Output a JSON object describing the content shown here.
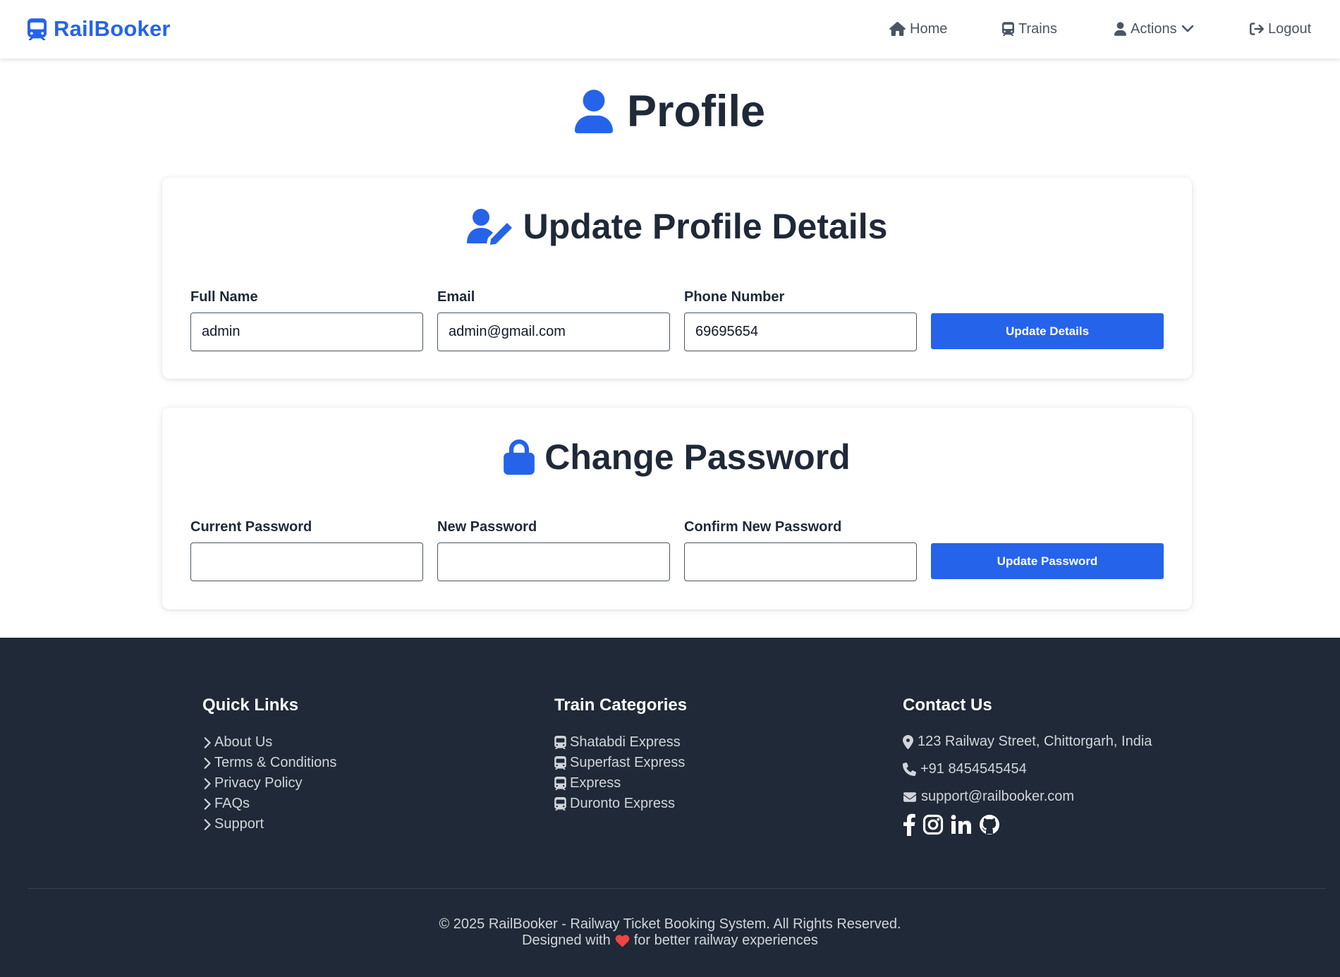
{
  "brand": {
    "name": "RailBooker",
    "icon": "train-icon",
    "color": "#2563eb"
  },
  "nav": {
    "items": [
      {
        "label": "Home",
        "icon": "home-icon"
      },
      {
        "label": "Trains",
        "icon": "train-icon"
      },
      {
        "label": "Actions",
        "icon": "user-icon",
        "dropdown_icon": "chevron-down-icon"
      },
      {
        "label": "Logout",
        "icon": "logout-icon"
      }
    ]
  },
  "page": {
    "title": "Profile",
    "title_icon": "user-icon"
  },
  "update_profile": {
    "title": "Update Profile Details",
    "title_icon": "user-edit-icon",
    "fields": [
      {
        "label": "Full Name",
        "value": "admin"
      },
      {
        "label": "Email",
        "value": "admin@gmail.com"
      },
      {
        "label": "Phone Number",
        "value": "69695654"
      }
    ],
    "button_label": "Update Details"
  },
  "change_password": {
    "title": "Change Password",
    "title_icon": "lock-icon",
    "fields": [
      {
        "label": "Current Password",
        "value": ""
      },
      {
        "label": "New Password",
        "value": ""
      },
      {
        "label": "Confirm New Password",
        "value": ""
      }
    ],
    "button_label": "Update Password"
  },
  "footer": {
    "quick_links": {
      "heading": "Quick Links",
      "items": [
        "About Us",
        "Terms & Conditions",
        "Privacy Policy",
        "FAQs",
        "Support"
      ]
    },
    "train_categories": {
      "heading": "Train Categories",
      "items": [
        "Shatabdi Express",
        "Superfast Express",
        "Express",
        "Duronto Express"
      ]
    },
    "contact": {
      "heading": "Contact Us",
      "address": "123 Railway Street, Chittorgarh, India",
      "phone": "+91 8454545454",
      "email": "support@railbooker.com",
      "socials": [
        "facebook-icon",
        "instagram-icon",
        "linkedin-icon",
        "github-icon"
      ]
    },
    "copyright": "© 2025 RailBooker - Railway Ticket Booking System. All Rights Reserved.",
    "designed_prefix": "Designed with",
    "designed_suffix": "for better railway experiences",
    "heart_color": "#ef4444"
  },
  "colors": {
    "primary": "#2563eb",
    "footer_bg": "#1f2937",
    "text_dark": "#1f2937"
  }
}
